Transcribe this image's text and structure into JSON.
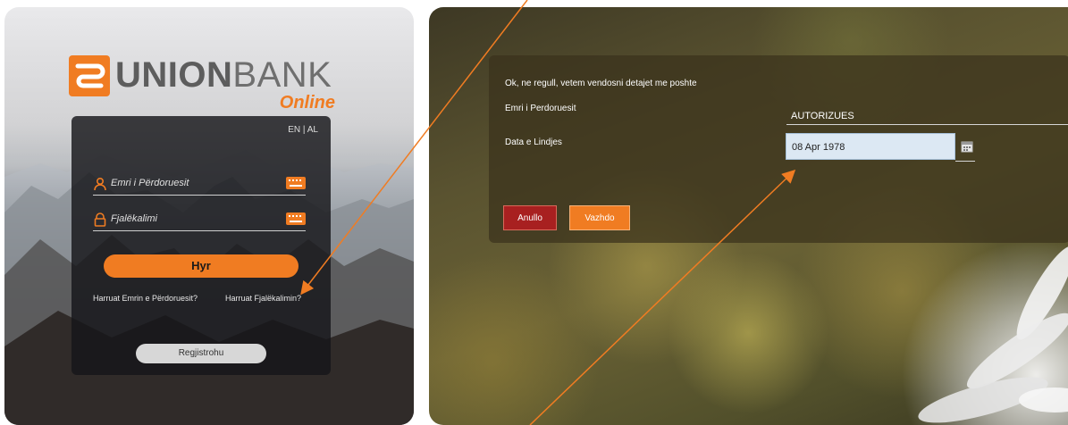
{
  "login": {
    "brand_prefix": "UNION",
    "brand_suffix": "BANK",
    "brand_sub": "Online",
    "lang_en": "EN",
    "lang_sep": "|",
    "lang_al": "AL",
    "username_placeholder": "Emri i Përdoruesit",
    "password_placeholder": "Fjalëkalimi",
    "login_button": "Hyr",
    "forgot_username": "Harruat Emrin e Përdoruesit?",
    "forgot_password": "Harruat Fjalëkalimin?",
    "register_button": "Regjistrohu"
  },
  "recovery": {
    "intro": "Ok, ne regull, vetem vendosni detajet me poshte",
    "username_label": "Emri i Perdoruesit",
    "username_value": "AUTORIZUES",
    "dob_label": "Data e Lindjes",
    "dob_value": "08 Apr 1978",
    "cancel_button": "Anullo",
    "continue_button": "Vazhdo"
  },
  "colors": {
    "accent_orange": "#f07c22",
    "cancel_red": "#a82020",
    "annotation_arrow": "#f07c22"
  },
  "icons": [
    "union-bank-logo-icon",
    "user-icon",
    "lock-icon",
    "keyboard-icon",
    "calendar-icon"
  ]
}
